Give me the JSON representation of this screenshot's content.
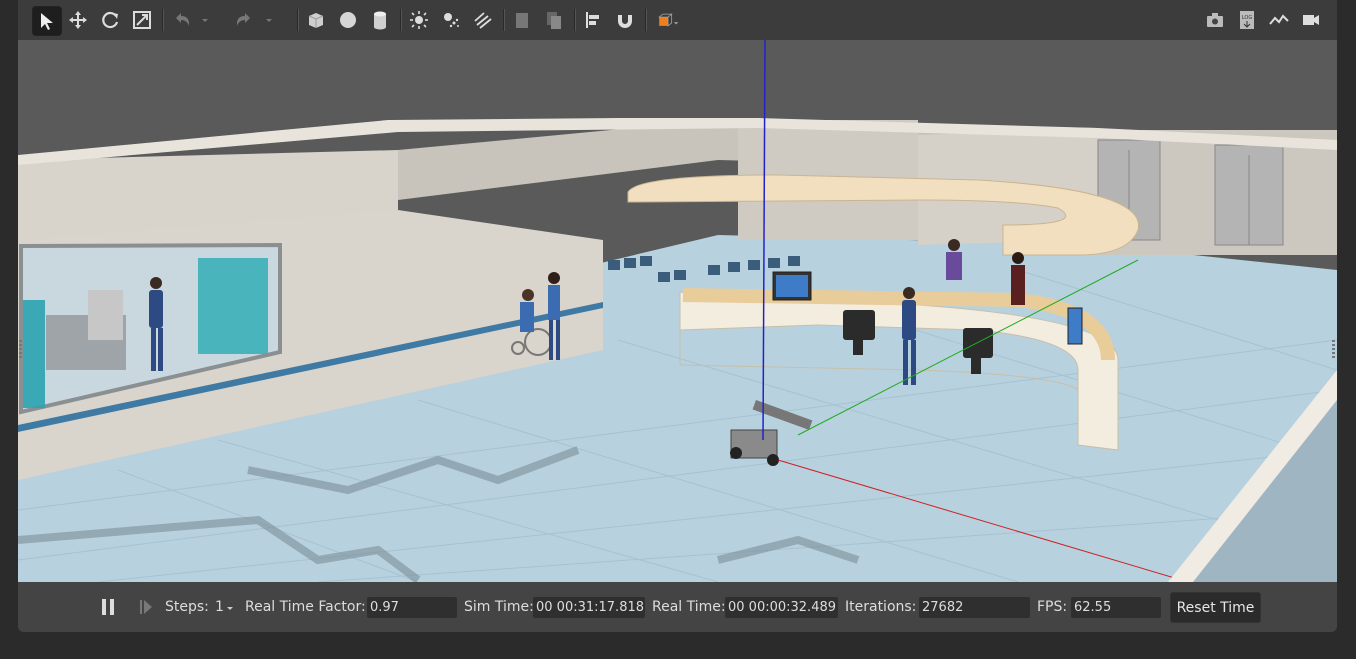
{
  "toolbar": {
    "tools": [
      "select-mode",
      "translate-mode",
      "rotate-mode",
      "scale-mode",
      "undo",
      "redo",
      "box",
      "sphere",
      "cylinder",
      "point-light",
      "spot-light",
      "directional-light",
      "copy",
      "paste",
      "align",
      "snap",
      "view-angle"
    ],
    "right_tools": [
      "screenshot",
      "log",
      "plot",
      "video"
    ]
  },
  "scene": {
    "description_colors": {
      "floor": "#b9d2e0",
      "wall": "#d9d4cc",
      "desk": "#f1ead9",
      "accent": "#3a7aa8"
    }
  },
  "status": {
    "steps_label": "Steps:",
    "steps_value": "1",
    "rtf_label": "Real Time Factor:",
    "rtf_value": "0.97",
    "sim_time_label": "Sim Time:",
    "sim_time_value": "00 00:31:17.818",
    "real_time_label": "Real Time:",
    "real_time_value": "00 00:00:32.489",
    "iterations_label": "Iterations:",
    "iterations_value": "27682",
    "fps_label": "FPS:",
    "fps_value": "62.55",
    "reset_label": "Reset Time"
  }
}
